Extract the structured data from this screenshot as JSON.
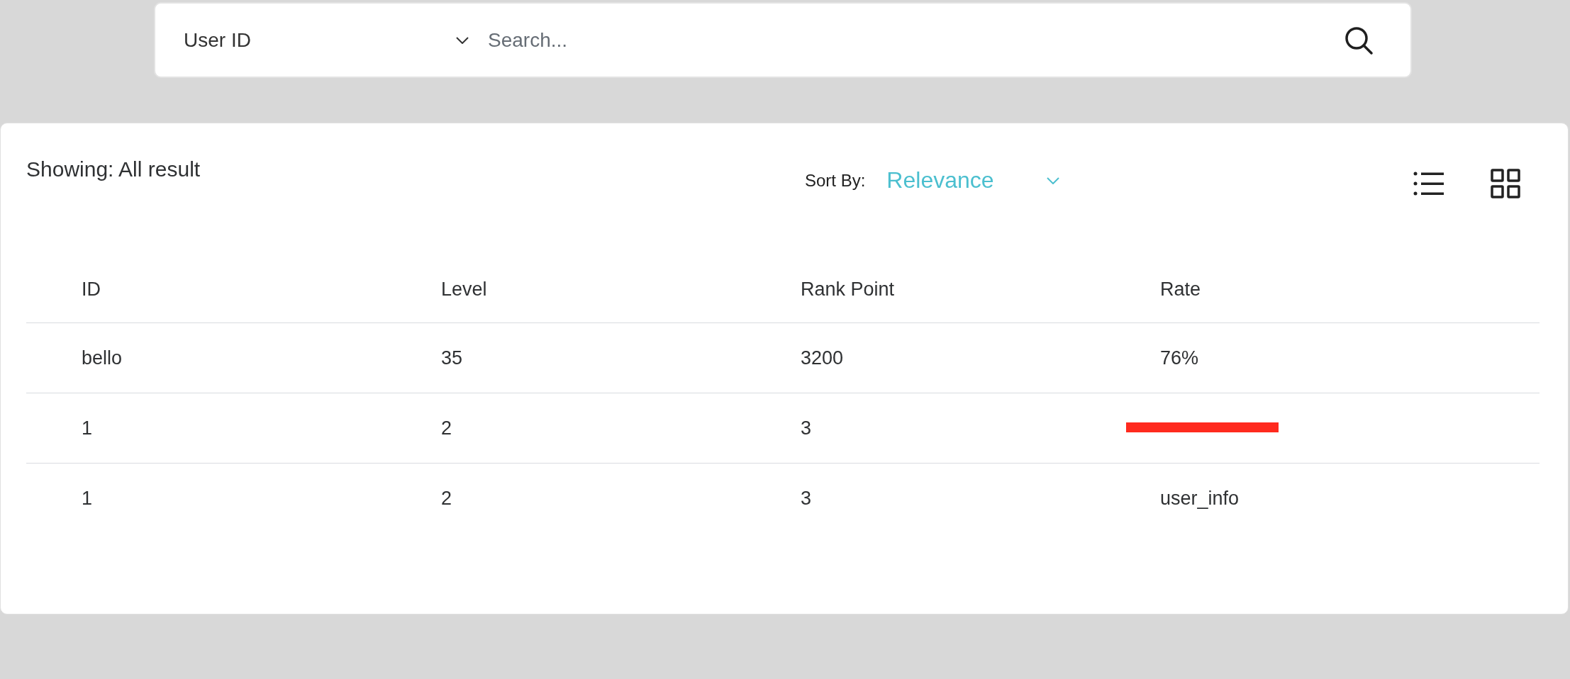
{
  "search": {
    "field_select": "User ID",
    "placeholder": "Search..."
  },
  "results": {
    "showing": "Showing: All result",
    "sort_label": "Sort By:",
    "sort_value": "Relevance"
  },
  "table": {
    "columns": [
      "ID",
      "Level",
      "Rank Point",
      "Rate"
    ],
    "rows": [
      {
        "cells": [
          "bello",
          "35",
          "3200",
          "76%"
        ],
        "redacted": false
      },
      {
        "cells": [
          "1",
          "2",
          "3"
        ],
        "redacted": true
      },
      {
        "cells": [
          "1",
          "2",
          "3",
          "user_info"
        ],
        "redacted": false
      }
    ]
  }
}
